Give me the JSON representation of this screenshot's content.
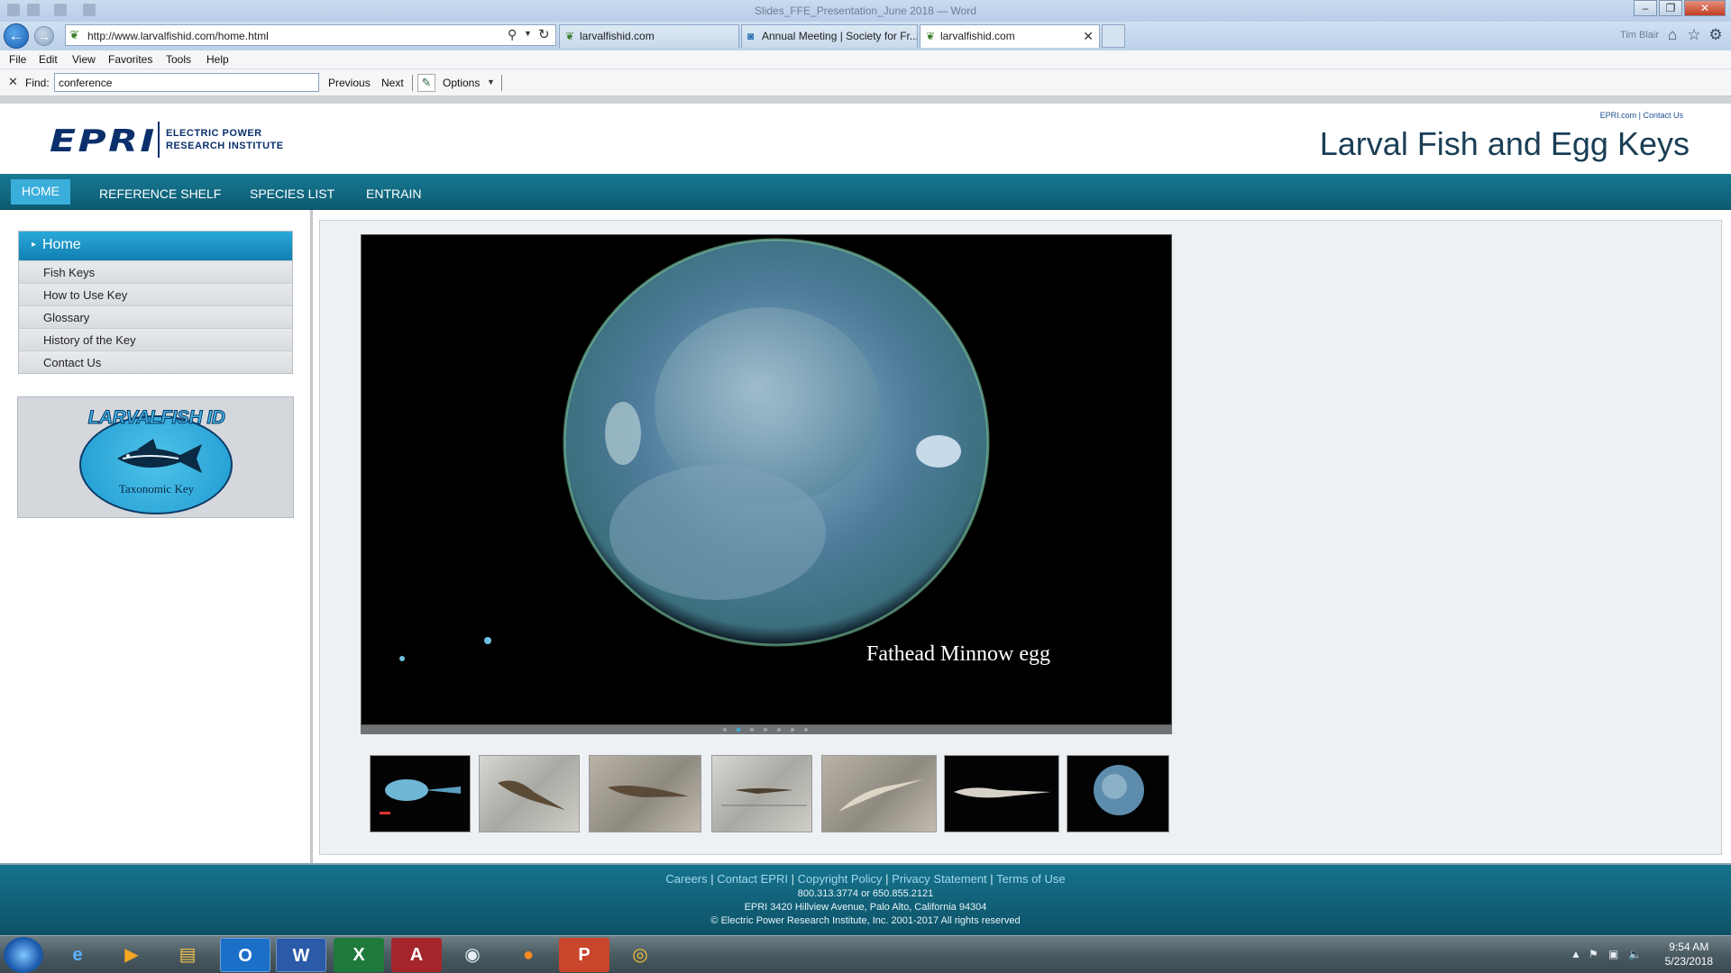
{
  "window": {
    "title": "Slides_FFE_Presentation_June 2018 — Word",
    "user": "Tim Blair"
  },
  "browser": {
    "url": "http://www.larvalfishid.com/home.html",
    "tabs": [
      {
        "label": "larvalfishid.com",
        "active": false,
        "icon": "leaf-icon"
      },
      {
        "label": "Annual Meeting | Society for Fr...",
        "active": false,
        "icon": "society-icon"
      },
      {
        "label": "larvalfishid.com",
        "active": true,
        "icon": "leaf-icon"
      }
    ],
    "menu": [
      "File",
      "Edit",
      "View",
      "Favorites",
      "Tools",
      "Help"
    ],
    "find": {
      "label": "Find:",
      "value": "conference",
      "previous": "Previous",
      "next": "Next",
      "options": "Options"
    }
  },
  "site": {
    "logo_text": "EPRI",
    "logo_tagline_1": "ELECTRIC POWER",
    "logo_tagline_2": "RESEARCH INSTITUTE",
    "top_link_1": "EPRI.com",
    "top_link_2": "Contact Us",
    "title": "Larval Fish and Egg Keys",
    "nav": [
      "HOME",
      "REFERENCE SHELF",
      "SPECIES LIST",
      "ENTRAIN"
    ],
    "side_menu": {
      "home": "Home",
      "items": [
        "Fish Keys",
        "How to Use Key",
        "Glossary",
        "History of the Key",
        "Contact Us"
      ]
    },
    "badge_title": "LARVALFISH ID",
    "badge_caption": "Taxonomic Key",
    "slide_caption": "Fathead Minnow egg",
    "footer": {
      "links": [
        "Careers",
        "Contact EPRI",
        "Copyright Policy",
        "Privacy Statement",
        "Terms of Use"
      ],
      "phone": "800.313.3774 or 650.855.2121",
      "address": "EPRI 3420 Hillview Avenue, Palo Alto, California 94304",
      "copyright": "© Electric Power Research Institute, Inc. 2001-2017 All rights reserved"
    }
  },
  "taskbar": {
    "time": "9:54 AM",
    "date": "5/23/2018"
  },
  "colors": {
    "nav_bar": "#0f6a82",
    "nav_active": "#3aaedb",
    "epri_blue": "#0b2f6b",
    "footer": "#0f5c72"
  }
}
